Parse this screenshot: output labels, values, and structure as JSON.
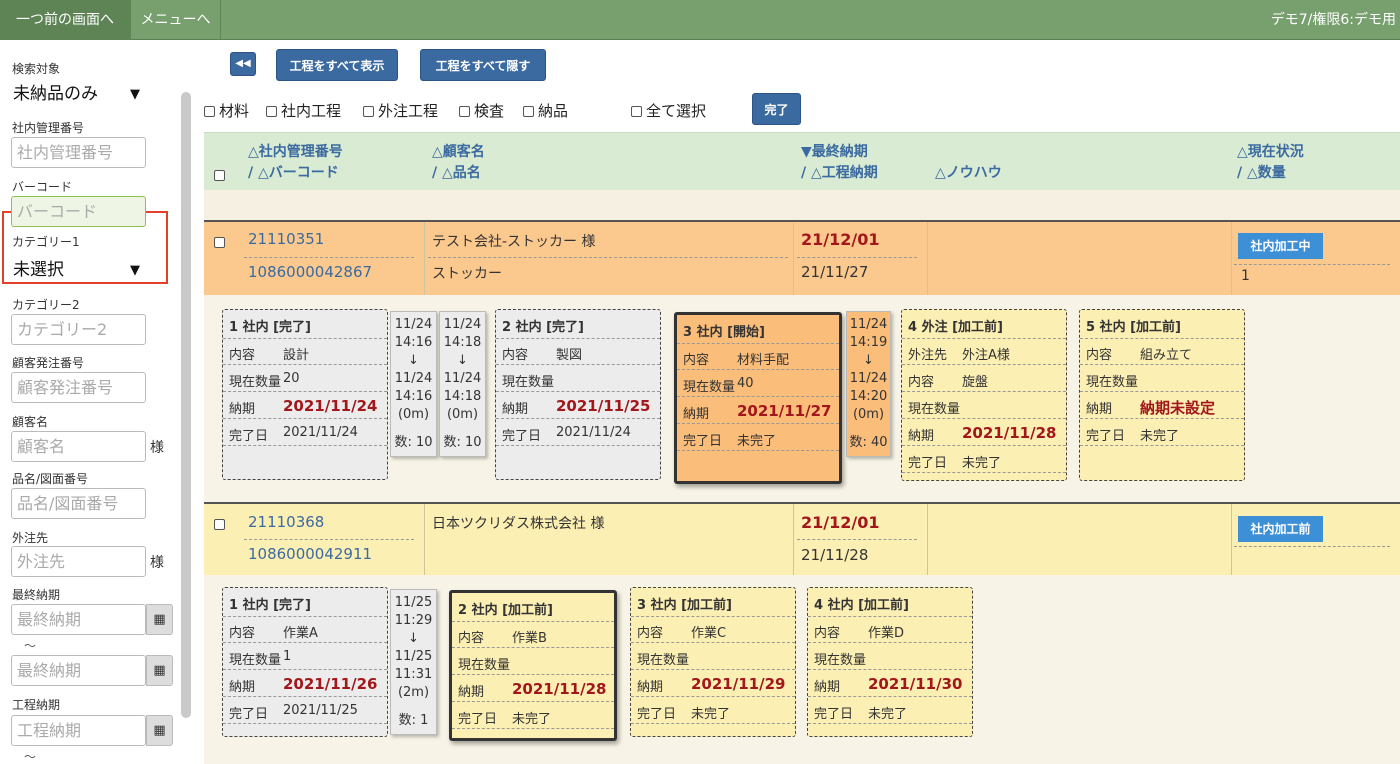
{
  "topbar": {
    "back": "一つ前の画面へ",
    "menu": "メニューへ",
    "user": "デモ7/権限6:デモ用"
  },
  "sidebar": {
    "search_target_label": "検索対象",
    "search_target_value": "未納品のみ",
    "mgmt_label": "社内管理番号",
    "mgmt_placeholder": "社内管理番号",
    "barcode_label": "バーコード",
    "barcode_placeholder": "バーコード",
    "cat1_label": "カテゴリー1",
    "cat1_value": "未選択",
    "cat2_label": "カテゴリー2",
    "cat2_placeholder": "カテゴリー2",
    "custorder_label": "顧客発注番号",
    "custorder_placeholder": "顧客発注番号",
    "customer_label": "顧客名",
    "customer_placeholder": "顧客名",
    "customer_suffix": "様",
    "product_label": "品名/図面番号",
    "product_placeholder": "品名/図面番号",
    "outsource_label": "外注先",
    "outsource_placeholder": "外注先",
    "outsource_suffix": "様",
    "final_due_label": "最終納期",
    "final_due_placeholder_from": "最終納期",
    "final_due_placeholder_to": "最終納期",
    "proc_due_label": "工程納期",
    "proc_due_placeholder": "工程納期",
    "tilde": "～"
  },
  "toolbar": {
    "show_all": "工程をすべて表示",
    "hide_all": "工程をすべて隠す",
    "done": "完了",
    "rewind_icon": "◀◀"
  },
  "filters": {
    "material": "材料",
    "inhouse": "社内工程",
    "outsource": "外注工程",
    "inspection": "検査",
    "delivery": "納品",
    "select_all": "全て選択"
  },
  "header": {
    "col1a": "△社内管理番号",
    "col1b": "/ △バーコード",
    "col2a": "△顧客名",
    "col2b": "/ △品名",
    "col3a": "▼最終納期",
    "col3b": "/ △工程納期",
    "col4": "△ノウハウ",
    "col5a": "△現在状況",
    "col5b": "/ △数量"
  },
  "orders": [
    {
      "id": "21110351",
      "barcode": "1086000042867",
      "customer": "テスト会社-ストッカー 様",
      "product": "ストッカー",
      "final_due": "21/12/01",
      "proc_due": "21/11/27",
      "status": "社内加工中",
      "qty": "1",
      "cards": [
        {
          "title": "1 社内 [完了]",
          "rows": [
            [
              "内容",
              "設計"
            ],
            [
              "現在数量",
              "20"
            ],
            [
              "納期",
              "2021/11/24"
            ],
            [
              "完了日",
              "2021/11/24"
            ]
          ]
        },
        {
          "title": "2 社内 [完了]",
          "rows": [
            [
              "内容",
              "製図"
            ],
            [
              "現在数量",
              ""
            ],
            [
              "納期",
              "2021/11/25"
            ],
            [
              "完了日",
              "2021/11/24"
            ]
          ]
        },
        {
          "title": "3 社内 [開始]",
          "rows": [
            [
              "内容",
              "材料手配"
            ],
            [
              "現在数量",
              "40"
            ],
            [
              "納期",
              "2021/11/27"
            ],
            [
              "完了日",
              "未完了"
            ]
          ]
        },
        {
          "title": "4 外注 [加工前]",
          "rows": [
            [
              "外注先",
              "外注A様"
            ],
            [
              "内容",
              "旋盤"
            ],
            [
              "現在数量",
              ""
            ],
            [
              "納期",
              "2021/11/28"
            ],
            [
              "完了日",
              "未完了"
            ]
          ]
        },
        {
          "title": "5 社内 [加工前]",
          "rows": [
            [
              "内容",
              "組み立て"
            ],
            [
              "現在数量",
              ""
            ],
            [
              "納期",
              "納期未設定"
            ],
            [
              "完了日",
              "未完了"
            ]
          ]
        }
      ],
      "conns": [
        [
          "11/24",
          "14:16",
          "↓",
          "11/24",
          "14:16",
          "(0m)",
          "数: 10"
        ],
        [
          "11/24",
          "14:18",
          "↓",
          "11/24",
          "14:18",
          "(0m)",
          "数: 10"
        ],
        [
          "11/24",
          "14:19",
          "↓",
          "11/24",
          "14:20",
          "(0m)",
          "数: 40"
        ]
      ]
    },
    {
      "id": "21110368",
      "barcode": "1086000042911",
      "customer": "日本ツクリダス株式会社 様",
      "product": "",
      "final_due": "21/12/01",
      "proc_due": "21/11/28",
      "status": "社内加工前",
      "qty": "",
      "cards": [
        {
          "title": "1 社内 [完了]",
          "rows": [
            [
              "内容",
              "作業A"
            ],
            [
              "現在数量",
              "1"
            ],
            [
              "納期",
              "2021/11/26"
            ],
            [
              "完了日",
              "2021/11/25"
            ]
          ]
        },
        {
          "title": "2 社内 [加工前]",
          "rows": [
            [
              "内容",
              "作業B"
            ],
            [
              "現在数量",
              ""
            ],
            [
              "納期",
              "2021/11/28"
            ],
            [
              "完了日",
              "未完了"
            ]
          ]
        },
        {
          "title": "3 社内 [加工前]",
          "rows": [
            [
              "内容",
              "作業C"
            ],
            [
              "現在数量",
              ""
            ],
            [
              "納期",
              "2021/11/29"
            ],
            [
              "完了日",
              "未完了"
            ]
          ]
        },
        {
          "title": "4 社内 [加工前]",
          "rows": [
            [
              "内容",
              "作業D"
            ],
            [
              "現在数量",
              ""
            ],
            [
              "納期",
              "2021/11/30"
            ],
            [
              "完了日",
              "未完了"
            ]
          ]
        }
      ],
      "conns": [
        [
          "11/25",
          "11:29",
          "↓",
          "11/25",
          "11:31",
          "(2m)",
          "数: 1"
        ]
      ]
    }
  ]
}
